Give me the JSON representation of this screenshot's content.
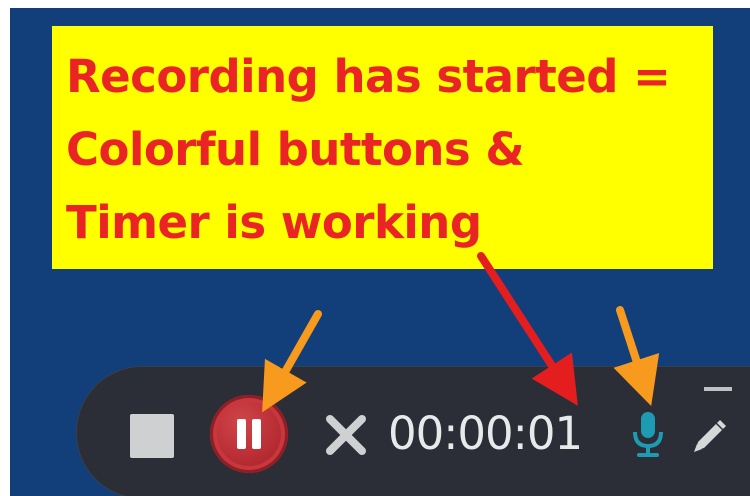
{
  "callout": {
    "lines": [
      "Recording has started =",
      "Colorful buttons &",
      "Timer is working"
    ]
  },
  "toolbar": {
    "timer": "00:00:01",
    "buttons": {
      "stop": "stop-icon",
      "pause": "pause-icon",
      "cancel": "close-icon",
      "mic": "microphone-icon",
      "pen": "pencil-icon",
      "minimize": "minimize-icon"
    }
  },
  "colors": {
    "background": "#123f7a",
    "callout_bg": "#ffff00",
    "callout_text": "#ea2424",
    "toolbar_bg": "#2b2e36",
    "pause_red": "#b72d33",
    "mic_teal": "#1e9bb3",
    "orange_arrow": "#f79a1d",
    "red_arrow": "#e41e1e"
  }
}
